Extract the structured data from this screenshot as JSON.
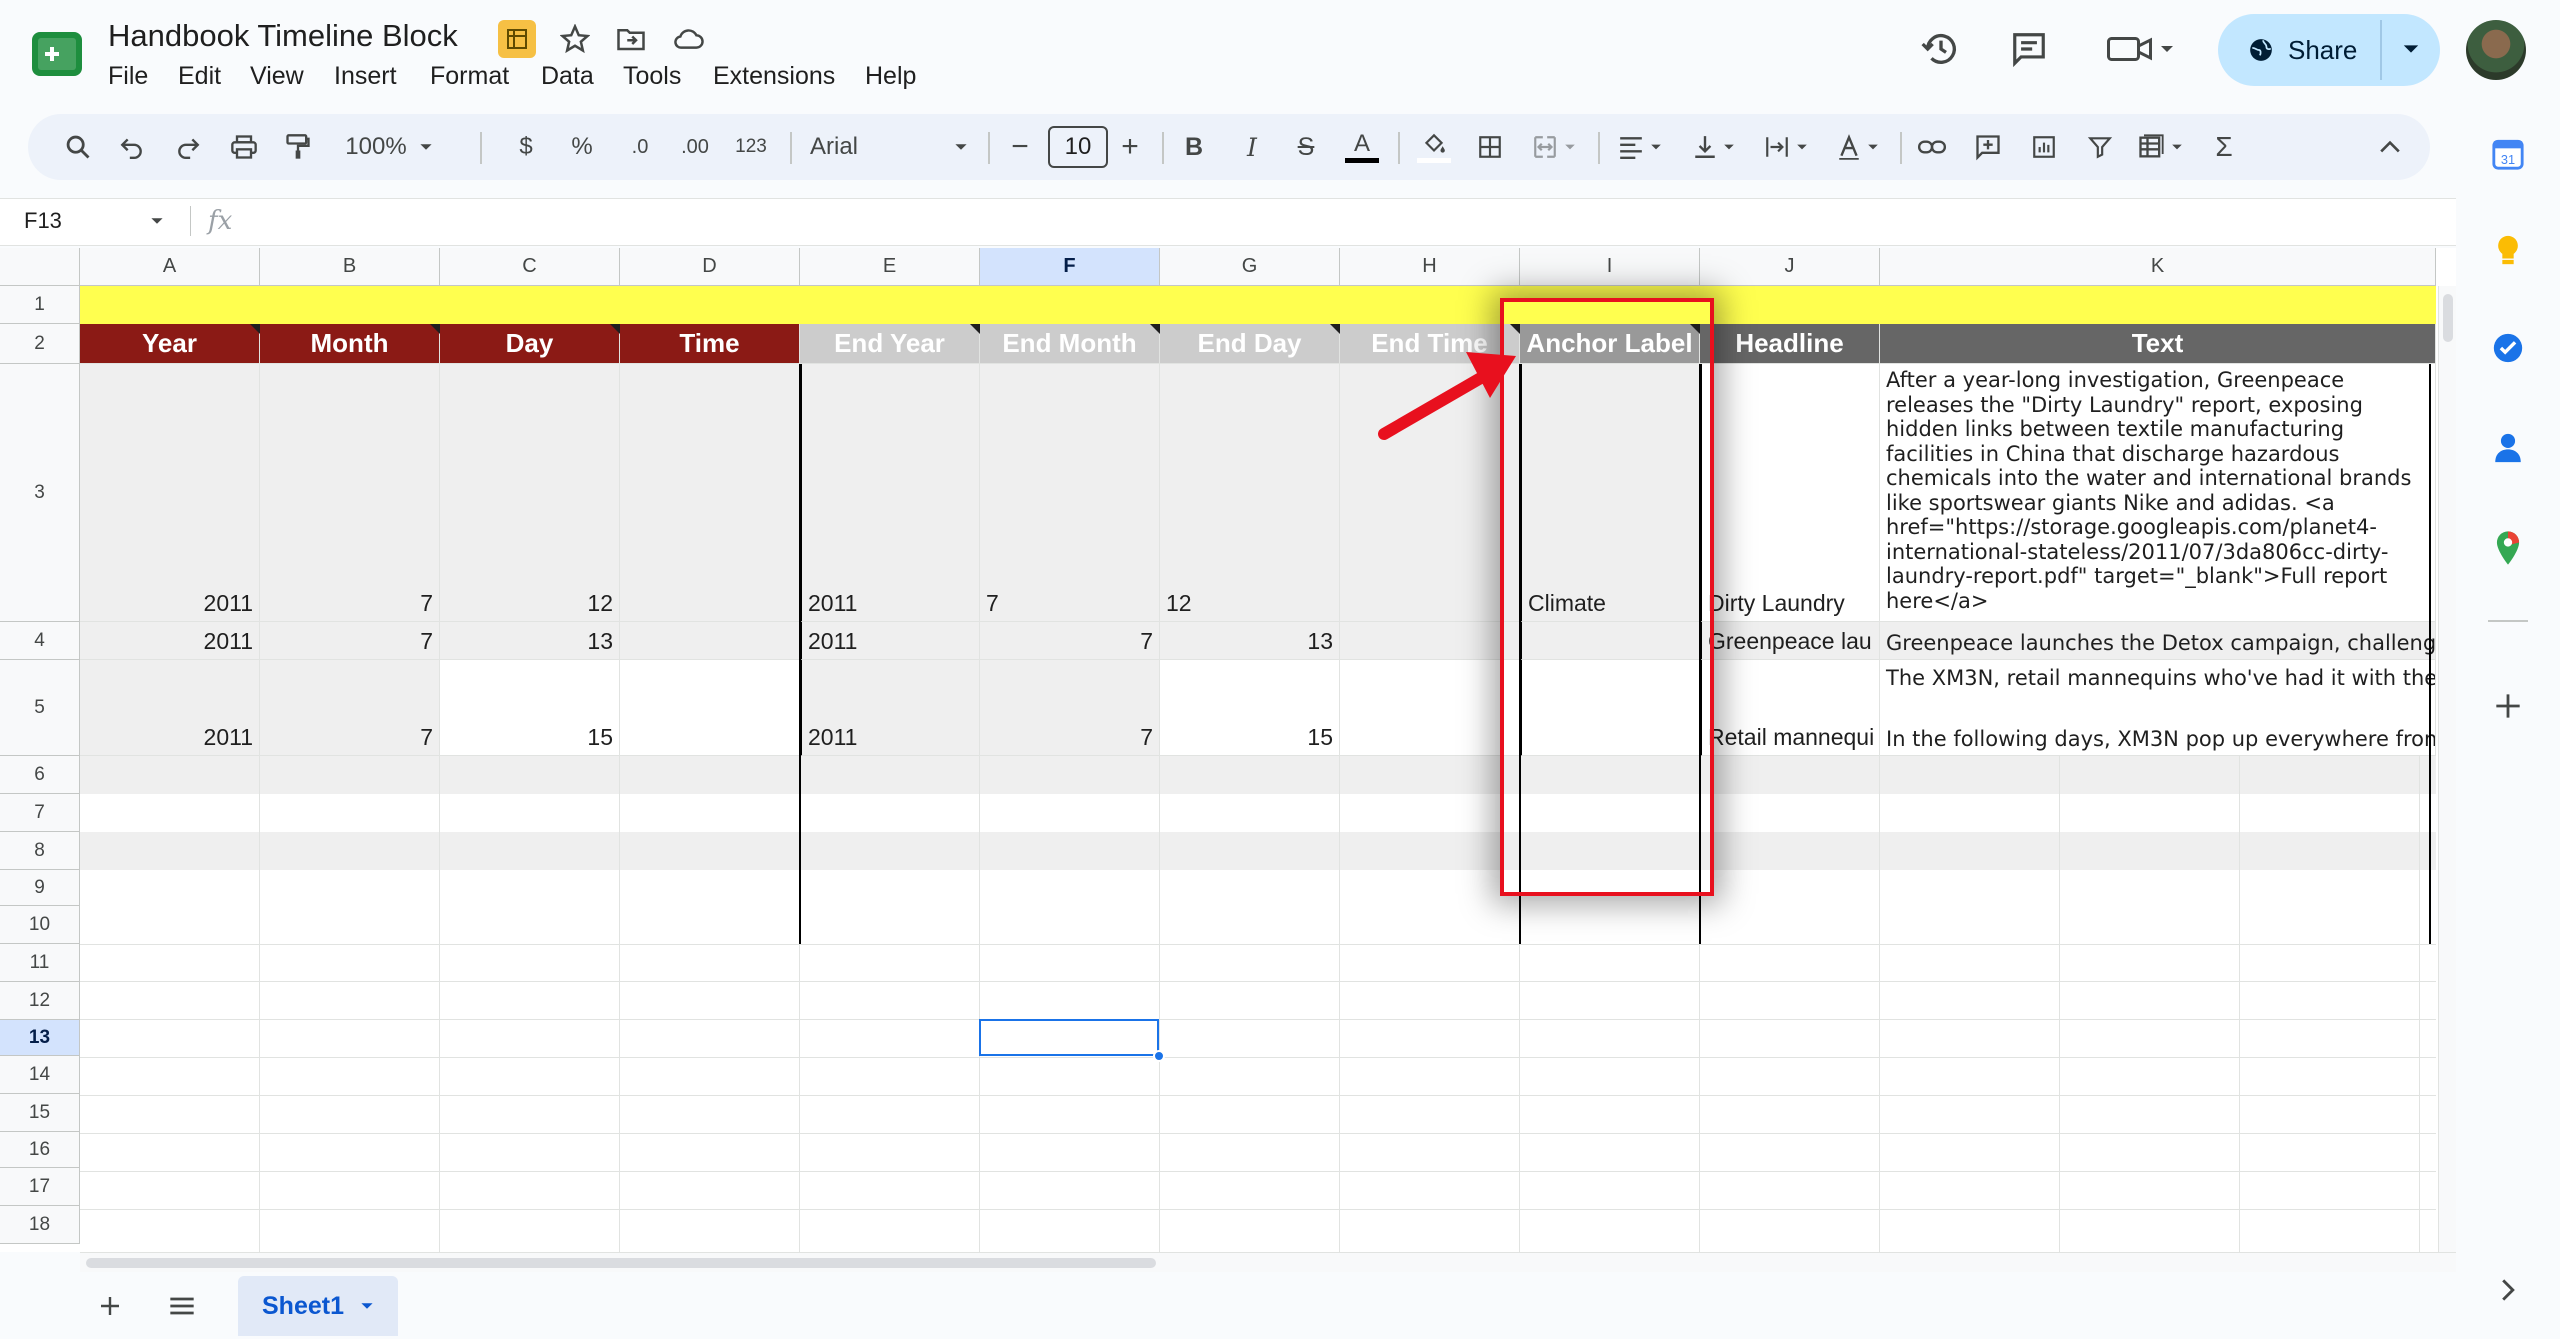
{
  "app": {
    "title": "Handbook Timeline Block",
    "menu": [
      "File",
      "Edit",
      "View",
      "Insert",
      "Format",
      "Data",
      "Tools",
      "Extensions",
      "Help"
    ],
    "share_label": "Share"
  },
  "toolbar": {
    "zoom": "100%",
    "currency": "$",
    "percent": "%",
    "dec_decrease": ".0",
    "dec_increase": ".00",
    "number_format": "123",
    "font": "Arial",
    "font_size": "10",
    "minus": "−",
    "plus": "+",
    "bold": "B",
    "italic": "I",
    "strike": "S",
    "text_color": "A",
    "sigma": "Σ"
  },
  "formula_bar": {
    "name_box": "F13",
    "fx": "fx"
  },
  "columns": [
    "A",
    "B",
    "C",
    "D",
    "E",
    "F",
    "G",
    "H",
    "I",
    "J",
    "K"
  ],
  "rows": [
    "1",
    "2",
    "3",
    "4",
    "5",
    "6",
    "7",
    "8",
    "9",
    "10",
    "11",
    "12",
    "13",
    "14",
    "15",
    "16",
    "17",
    "18"
  ],
  "header_row": [
    "Year",
    "Month",
    "Day",
    "Time",
    "End Year",
    "End Month",
    "End Day",
    "End Time",
    "Anchor Label",
    "Headline",
    "Text"
  ],
  "data_rows": [
    {
      "A": "2011",
      "B": "7",
      "C": "12",
      "D": "",
      "E": "2011",
      "F": "7",
      "G": "12",
      "H": "",
      "I": "Climate",
      "J": "Dirty Laundry",
      "K": "After a year-long investigation, Greenpeace releases the \"Dirty Laundry\" report, exposing hidden links between textile manufacturing facilities in China that discharge hazardous chemicals into the water and international brands like sportswear giants Nike and adidas. <a href=\"https://storage.googleapis.com/planet4-international-stateless/2011/07/3da806cc-dirty-laundry-report.pdf\" target=\"_blank\">Full report here</a>"
    },
    {
      "A": "2011",
      "B": "7",
      "C": "13",
      "D": "",
      "E": "2011",
      "F": "7",
      "G": "13",
      "H": "",
      "I": "",
      "J": "Greenpeace lau",
      "K": "Greenpeace launches the Detox campaign, challeng"
    },
    {
      "A": "2011",
      "B": "7",
      "C": "15",
      "D": "",
      "E": "2011",
      "F": "7",
      "G": "15",
      "H": "",
      "I": "",
      "J": "Retail mannequi",
      "K_top": "The XM3N, retail mannequins who've had it with the",
      "K": "In the following days, XM3N pop up everywhere fron"
    }
  ],
  "sheet_tab": "Sheet1",
  "colors": {
    "header_red": "#8b1a15",
    "header_gray": "#cccccc",
    "header_dark": "#666666",
    "row1_yellow": "#ffff4f",
    "annotation_red": "#e8101e",
    "selection_blue": "#1a73e8"
  },
  "icons": [
    "search-icon",
    "undo-icon",
    "redo-icon",
    "print-icon",
    "paint-format-icon",
    "fill-color-icon",
    "borders-icon",
    "merge-icon",
    "align-icon",
    "valign-icon",
    "wrap-icon",
    "rotate-icon",
    "link-icon",
    "comment-icon",
    "chart-icon",
    "filter-icon",
    "table-icon",
    "history-icon",
    "chat-icon",
    "meet-icon",
    "calendar-icon",
    "keep-icon",
    "tasks-icon",
    "contacts-icon",
    "maps-icon"
  ]
}
